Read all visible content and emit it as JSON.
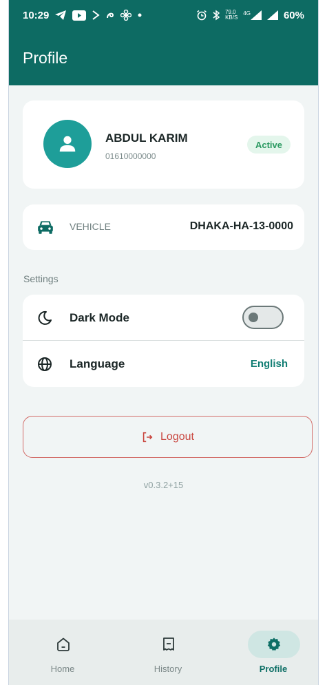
{
  "status_bar": {
    "time": "10:29",
    "left_icons": [
      "telegram-icon",
      "youtube-icon",
      "arrow-icon",
      "swirl-icon",
      "fan-icon",
      "dot-icon"
    ],
    "net_speed": "79.0",
    "net_unit": "KB/S",
    "network": "4G",
    "battery": "60%"
  },
  "app_bar": {
    "title": "Profile"
  },
  "profile": {
    "name": "ABDUL KARIM",
    "phone": "01610000000",
    "status": "Active"
  },
  "vehicle": {
    "label": "VEHICLE",
    "value": "DHAKA-HA-13-0000"
  },
  "settings": {
    "section_label": "Settings",
    "dark_mode_label": "Dark Mode",
    "dark_mode_on": false,
    "language_label": "Language",
    "language_value": "English"
  },
  "logout_label": "Logout",
  "version": "v0.3.2+15",
  "bottom_nav": {
    "items": [
      {
        "label": "Home",
        "icon": "home-icon",
        "active": false
      },
      {
        "label": "History",
        "icon": "receipt-icon",
        "active": false
      },
      {
        "label": "Profile",
        "icon": "gear-icon",
        "active": true
      }
    ]
  },
  "colors": {
    "primary": "#0d6b63",
    "accent": "#1e9e99",
    "active_badge": "#2c9a62",
    "logout": "#c9463f"
  }
}
